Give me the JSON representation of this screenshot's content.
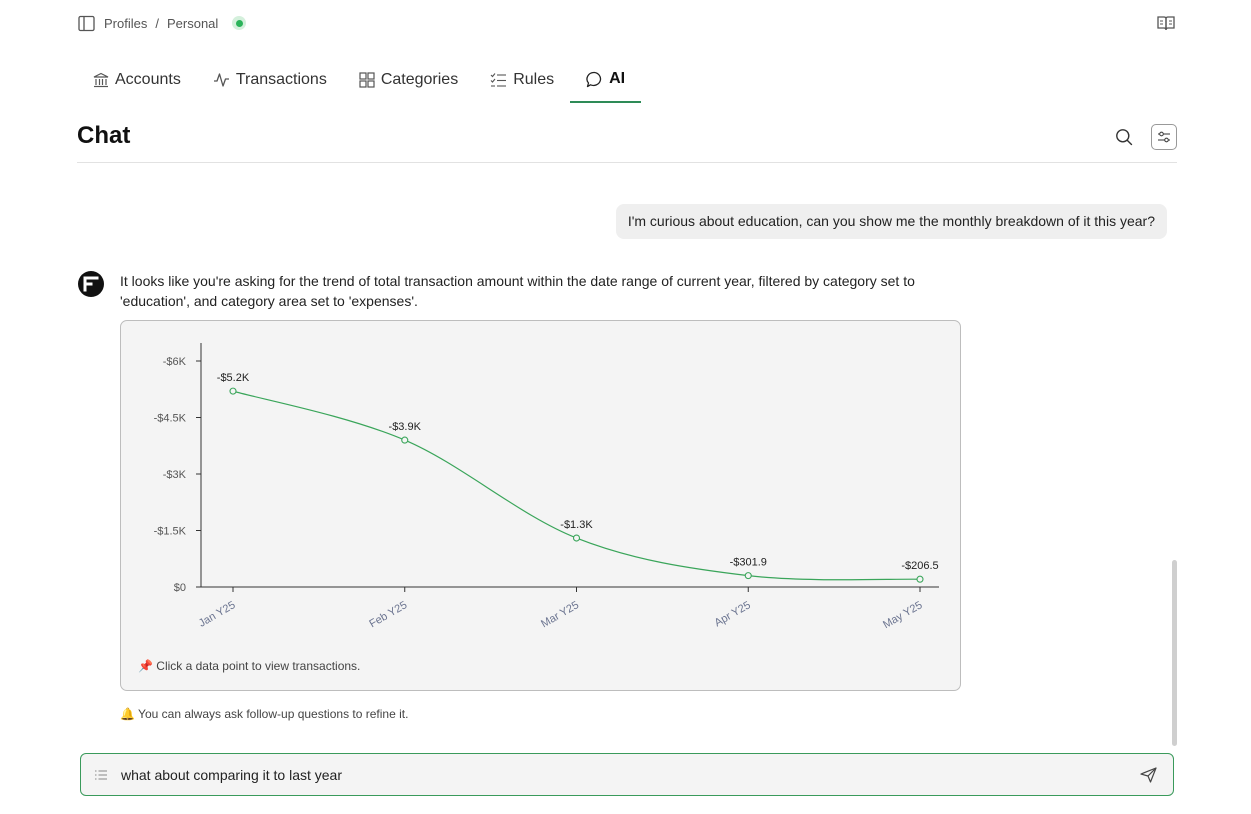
{
  "breadcrumb": {
    "items": [
      "Profiles",
      "Personal"
    ],
    "separator": "/"
  },
  "tabs": [
    {
      "label": "Accounts",
      "icon": "bank-icon",
      "active": false
    },
    {
      "label": "Transactions",
      "icon": "activity-icon",
      "active": false
    },
    {
      "label": "Categories",
      "icon": "grid-icon",
      "active": false
    },
    {
      "label": "Rules",
      "icon": "list-check-icon",
      "active": false
    },
    {
      "label": "AI",
      "icon": "chat-bubble-icon",
      "active": true
    }
  ],
  "page": {
    "title": "Chat"
  },
  "messages": {
    "user": "I'm curious about education, can you show me the monthly breakdown of it this year?",
    "bot": "It looks like you're asking for the trend of total transaction amount within the date range of current year, filtered by category set to 'education', and category area set to 'expenses'.",
    "chart_hint": "📌 Click a data point to view transactions.",
    "followup": "🔔 You can always ask follow-up questions to refine it."
  },
  "composer": {
    "value": "what about comparing it to last year",
    "placeholder": ""
  },
  "colors": {
    "accent": "#2e8b57",
    "line": "#3aa55a",
    "status": "#2bb35a"
  },
  "chart_data": {
    "type": "line",
    "categories": [
      "Jan Y25",
      "Feb Y25",
      "Mar Y25",
      "Apr Y25",
      "May Y25"
    ],
    "values": [
      -5200,
      -3900,
      -1300,
      -301.9,
      -206.5
    ],
    "data_labels": [
      "-$5.2K",
      "-$3.9K",
      "-$1.3K",
      "-$301.9",
      "-$206.5"
    ],
    "y_ticks": [
      0,
      -1500,
      -3000,
      -4500,
      -6000
    ],
    "y_tick_labels": [
      "$0",
      "-$1.5K",
      "-$3K",
      "-$4.5K",
      "-$6K"
    ],
    "ylim": [
      0,
      -6000
    ],
    "y_inverted": true,
    "title": "",
    "xlabel": "",
    "ylabel": "",
    "grid": false,
    "legend": "none"
  }
}
